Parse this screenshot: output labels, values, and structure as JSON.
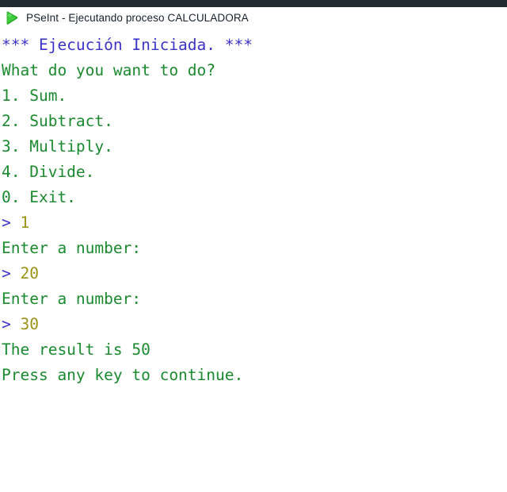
{
  "window": {
    "title": "PSeInt - Ejecutando proceso CALCULADORA",
    "icon": "play-icon",
    "icon_color": "#2ab12a",
    "titlebar_bg": "#ffffff",
    "top_strip_color": "#1d2a30",
    "title_color": "#17212b"
  },
  "console": {
    "background": "#ffffff",
    "colors": {
      "system": "#3b32c8",
      "output": "#1a8a2e",
      "prompt": "#3b32c8",
      "input": "#9a9214"
    },
    "lines": [
      {
        "kind": "system",
        "text": "*** Ejecución Iniciada. ***"
      },
      {
        "kind": "output",
        "text": "What do you want to do?"
      },
      {
        "kind": "output",
        "text": "1. Sum."
      },
      {
        "kind": "output",
        "text": "2. Subtract."
      },
      {
        "kind": "output",
        "text": "3. Multiply."
      },
      {
        "kind": "output",
        "text": "4. Divide."
      },
      {
        "kind": "output",
        "text": "0. Exit."
      },
      {
        "kind": "entry",
        "prompt": "> ",
        "value": "1"
      },
      {
        "kind": "output",
        "text": "Enter a number:"
      },
      {
        "kind": "entry",
        "prompt": "> ",
        "value": "20"
      },
      {
        "kind": "output",
        "text": "Enter a number:"
      },
      {
        "kind": "entry",
        "prompt": "> ",
        "value": "30"
      },
      {
        "kind": "output",
        "text": "The result is 50"
      },
      {
        "kind": "output",
        "text": "Press any key to continue."
      }
    ]
  }
}
